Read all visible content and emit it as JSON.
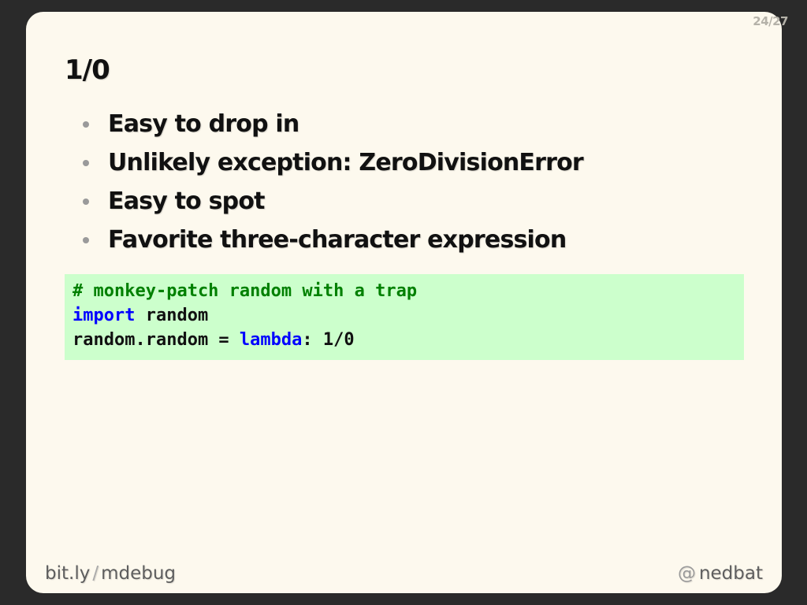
{
  "slide": {
    "page_counter": "24/27",
    "title": "1/0",
    "bullets": [
      "Easy to drop in",
      "Unlikely exception: ZeroDivisionError",
      "Easy to spot",
      "Favorite three-character expression"
    ],
    "code": {
      "line1_comment": "# monkey-patch random with a trap",
      "line2_keyword": "import",
      "line2_rest": " random",
      "line3_start": "random.random = ",
      "line3_keyword": "lambda",
      "line3_end": ": 1/0"
    },
    "footer": {
      "left_host": "bit.ly",
      "left_sep": "/",
      "left_path": "mdebug",
      "right_at": "@",
      "right_handle": "nedbat"
    }
  },
  "colors": {
    "background": "#2a2a2a",
    "slide_bg": "#fdf9ee",
    "code_bg": "#ccffcc",
    "comment": "#008000",
    "keyword": "#0000ff"
  }
}
